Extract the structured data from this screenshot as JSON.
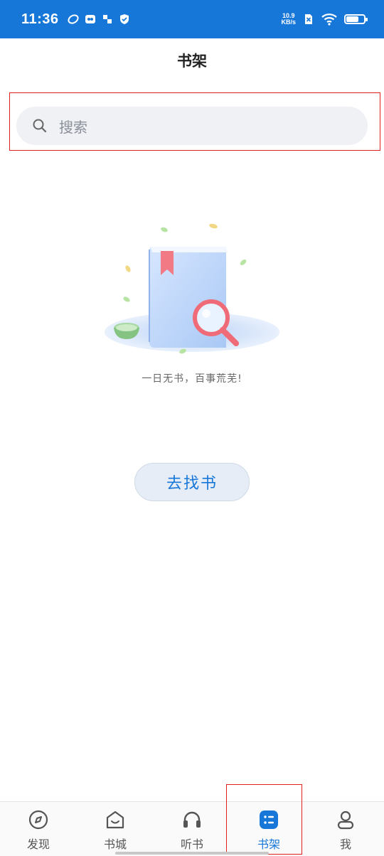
{
  "status_bar": {
    "time": "11:36",
    "net_speed_value": "10.9",
    "net_speed_unit": "KB/s",
    "battery_level": 0.7
  },
  "header": {
    "title": "书架"
  },
  "search": {
    "placeholder": "搜索"
  },
  "empty_state": {
    "message": "一日无书，百事荒芜!",
    "button_label": "去找书"
  },
  "tabs": [
    {
      "label": "发现",
      "icon": "compass-icon",
      "active": false
    },
    {
      "label": "书城",
      "icon": "bookstore-icon",
      "active": false
    },
    {
      "label": "听书",
      "icon": "headphones-icon",
      "active": false
    },
    {
      "label": "书架",
      "icon": "bookshelf-icon",
      "active": true
    },
    {
      "label": "我",
      "icon": "user-icon",
      "active": false
    }
  ],
  "colors": {
    "accent": "#1677d9",
    "highlight": "#e02020"
  }
}
